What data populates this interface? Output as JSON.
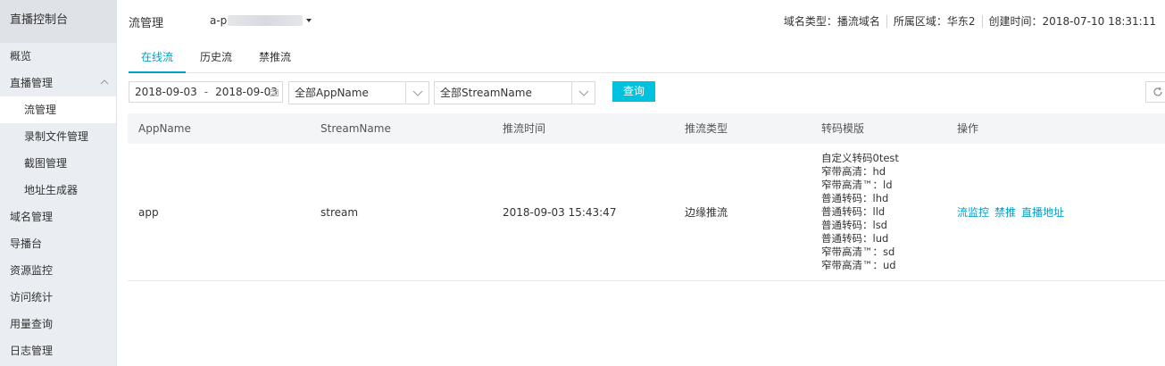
{
  "sidebar": {
    "title": "直播控制台",
    "items": [
      {
        "label": "概览"
      },
      {
        "label": "直播管理"
      },
      {
        "label": "流管理"
      },
      {
        "label": "录制文件管理"
      },
      {
        "label": "截图管理"
      },
      {
        "label": "地址生成器"
      },
      {
        "label": "域名管理"
      },
      {
        "label": "导播台"
      },
      {
        "label": "资源监控"
      },
      {
        "label": "访问统计"
      },
      {
        "label": "用量查询"
      },
      {
        "label": "日志管理"
      }
    ]
  },
  "header": {
    "title": "流管理",
    "domain_prefix": "a-p",
    "domain_type": "域名类型：播流域名",
    "region": "所属区域：华东2",
    "created": "创建时间：2018-07-10 18:31:11"
  },
  "tabs": [
    {
      "label": "在线流",
      "active": true
    },
    {
      "label": "历史流",
      "active": false
    },
    {
      "label": "禁推流",
      "active": false
    }
  ],
  "filters": {
    "date_start": "2018-09-03",
    "date_separator": "-",
    "date_end": "2018-09-03",
    "app_select": "全部AppName",
    "stream_select": "全部StreamName",
    "query_label": "查询"
  },
  "table": {
    "columns": [
      "AppName",
      "StreamName",
      "推流时间",
      "推流类型",
      "转码模版",
      "操作"
    ],
    "rows": [
      {
        "app": "app",
        "stream": "stream",
        "push_time": "2018-09-03 15:43:47",
        "push_type": "边缘推流",
        "templates": [
          "自定义转码0test",
          "窄带高清：hd",
          "窄带高清™：ld",
          "普通转码：lhd",
          "普通转码：lld",
          "普通转码：lsd",
          "普通转码：lud",
          "窄带高清™：sd",
          "窄带高清™：ud"
        ],
        "actions": [
          "流监控",
          "禁推",
          "直播地址"
        ]
      }
    ]
  },
  "colors": {
    "accent": "#00a2ca",
    "button": "#00c1de",
    "sidebar_bg": "#eaedf1"
  }
}
